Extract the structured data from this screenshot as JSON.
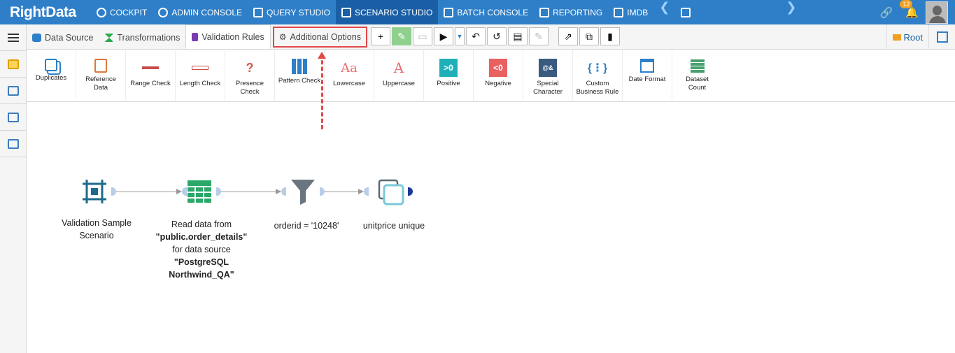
{
  "brand": {
    "logo_text": "RightData"
  },
  "nav": {
    "items": [
      {
        "label": "COCKPIT",
        "icon": "gauge-icon"
      },
      {
        "label": "ADMIN CONSOLE",
        "icon": "gear-icon"
      },
      {
        "label": "QUERY STUDIO",
        "icon": "database-icon"
      },
      {
        "label": "SCENARIO STUDIO",
        "icon": "flow-icon",
        "active": true
      },
      {
        "label": "BATCH CONSOLE",
        "icon": "batch-icon"
      },
      {
        "label": "REPORTING",
        "icon": "report-icon"
      },
      {
        "label": "IMDB",
        "icon": "columns-icon"
      }
    ],
    "notifications_count": "12"
  },
  "tabs": {
    "data_source": "Data Source",
    "transformations": "Transformations",
    "validation_rules": "Validation Rules",
    "additional_options": "Additional Options"
  },
  "root_label": "Root",
  "rules": [
    {
      "label": "Duplicates",
      "icon": "duplicates-icon"
    },
    {
      "label": "Reference\nData",
      "icon": "reference-data-icon"
    },
    {
      "label": "Range Check",
      "icon": "range-check-icon"
    },
    {
      "label": "Length Check",
      "icon": "length-check-icon"
    },
    {
      "label": "Presence\nCheck",
      "icon": "presence-check-icon"
    },
    {
      "label": "Pattern Check",
      "icon": "pattern-check-icon"
    },
    {
      "label": "Lowercase",
      "icon": "lowercase-icon",
      "glyph": "Aa"
    },
    {
      "label": "Uppercase",
      "icon": "uppercase-icon",
      "glyph": "A"
    },
    {
      "label": "Positive",
      "icon": "positive-icon",
      "glyph": ">0"
    },
    {
      "label": "Negative",
      "icon": "negative-icon",
      "glyph": "<0"
    },
    {
      "label": "Special\nCharacter",
      "icon": "special-character-icon",
      "glyph": "@&"
    },
    {
      "label": "Custom\nBusiness Rule",
      "icon": "custom-business-rule-icon"
    },
    {
      "label": "Date Format",
      "icon": "date-format-icon"
    },
    {
      "label": "Dataset\nCount",
      "icon": "dataset-count-icon"
    }
  ],
  "nodes": {
    "scenario_line1": "Validation Sample",
    "scenario_line2": "Scenario",
    "read_line1": "Read data from",
    "read_table": "\"public.order_details\"",
    "read_line3": "for data source",
    "read_source1": "\"PostgreSQL",
    "read_source2": "Northwind_QA\"",
    "filter_label": "orderid = '10248'",
    "unique_label": "unitprice unique"
  },
  "colors": {
    "topbar": "#2e7fc8",
    "active_nav": "#1a5fa6",
    "highlight": "#e04848",
    "node_teal": "#1e8a8a"
  }
}
